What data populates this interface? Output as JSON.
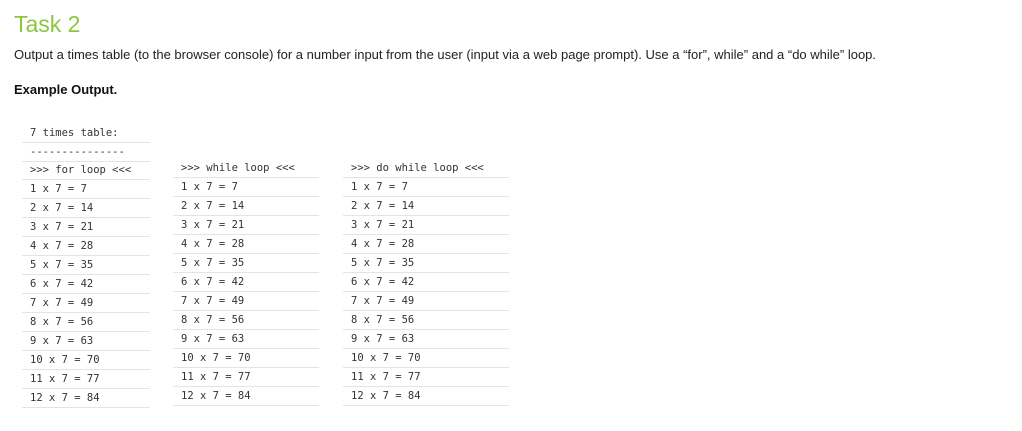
{
  "task": {
    "title": "Task 2",
    "description": "Output a times table (to the browser console) for a number input from the user (input via a web page prompt). Use a “for”, while” and a “do while” loop.",
    "example_heading": "Example Output."
  },
  "output": {
    "table_title": "7 times table:",
    "separator": "---------------",
    "columns": [
      {
        "header": ">>> for loop <<<",
        "lines": [
          "1 x 7 = 7",
          "2 x 7 = 14",
          "3 x 7 = 21",
          "4 x 7 = 28",
          "5 x 7 = 35",
          "6 x 7 = 42",
          "7 x 7 = 49",
          "8 x 7 = 56",
          "9 x 7 = 63",
          "10 x 7 = 70",
          "11 x 7 = 77",
          "12 x 7 = 84"
        ]
      },
      {
        "header": ">>> while loop <<<",
        "lines": [
          "1 x 7 = 7",
          "2 x 7 = 14",
          "3 x 7 = 21",
          "4 x 7 = 28",
          "5 x 7 = 35",
          "6 x 7 = 42",
          "7 x 7 = 49",
          "8 x 7 = 56",
          "9 x 7 = 63",
          "10 x 7 = 70",
          "11 x 7 = 77",
          "12 x 7 = 84"
        ]
      },
      {
        "header": ">>> do while loop <<<",
        "lines": [
          "1 x 7 = 7",
          "2 x 7 = 14",
          "3 x 7 = 21",
          "4 x 7 = 28",
          "5 x 7 = 35",
          "6 x 7 = 42",
          "7 x 7 = 49",
          "8 x 7 = 56",
          "9 x 7 = 63",
          "10 x 7 = 70",
          "11 x 7 = 77",
          "12 x 7 = 84"
        ]
      }
    ]
  }
}
